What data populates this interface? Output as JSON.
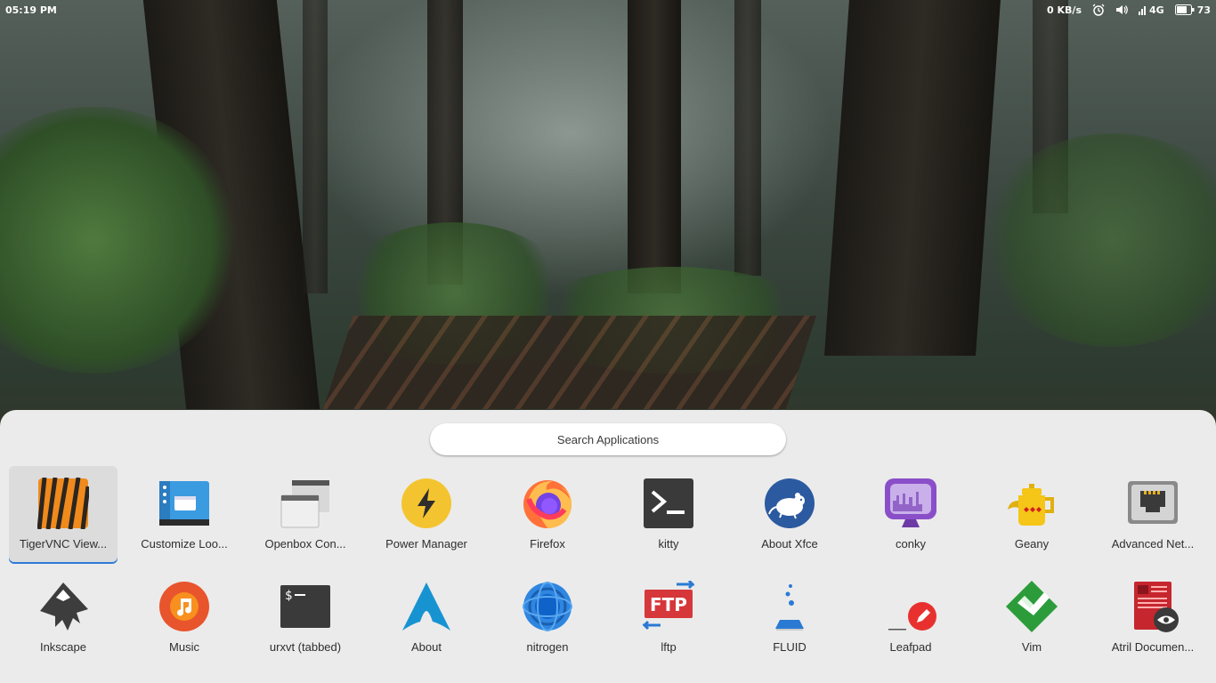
{
  "panel": {
    "clock": "05:19 PM",
    "net_speed": "0 KB/s",
    "network_label": "4G",
    "battery_level": "73",
    "icons": [
      "alarm-icon",
      "volume-icon",
      "signal-icon",
      "battery-icon"
    ]
  },
  "search": {
    "placeholder": "Search Applications"
  },
  "apps": {
    "row1": [
      {
        "label": "TigerVNC View...",
        "icon": "tigervnc-icon",
        "selected": true
      },
      {
        "label": "Customize Loo...",
        "icon": "customize-look-icon"
      },
      {
        "label": "Openbox Con...",
        "icon": "openbox-config-icon"
      },
      {
        "label": "Power Manager",
        "icon": "power-manager-icon"
      },
      {
        "label": "Firefox",
        "icon": "firefox-icon"
      },
      {
        "label": "kitty",
        "icon": "terminal-icon"
      },
      {
        "label": "About Xfce",
        "icon": "xfce-mouse-icon"
      },
      {
        "label": "conky",
        "icon": "conky-monitor-icon"
      },
      {
        "label": "Geany",
        "icon": "geany-teapot-icon"
      },
      {
        "label": "Advanced Net...",
        "icon": "network-ethernet-icon"
      }
    ],
    "row2": [
      {
        "label": "Inkscape",
        "icon": "inkscape-icon"
      },
      {
        "label": "Music",
        "icon": "music-icon"
      },
      {
        "label": "urxvt (tabbed)",
        "icon": "urxvt-terminal-icon"
      },
      {
        "label": "About",
        "icon": "arch-logo-icon"
      },
      {
        "label": "nitrogen",
        "icon": "nitrogen-icon"
      },
      {
        "label": "lftp",
        "icon": "ftp-icon"
      },
      {
        "label": "FLUID",
        "icon": "fluid-flask-icon"
      },
      {
        "label": "Leafpad",
        "icon": "leafpad-edit-icon"
      },
      {
        "label": "Vim",
        "icon": "vim-icon"
      },
      {
        "label": "Atril Documen...",
        "icon": "document-viewer-icon"
      }
    ]
  },
  "colors": {
    "accent": "#2e7ad6",
    "drawer_bg": "#ebebeb"
  }
}
